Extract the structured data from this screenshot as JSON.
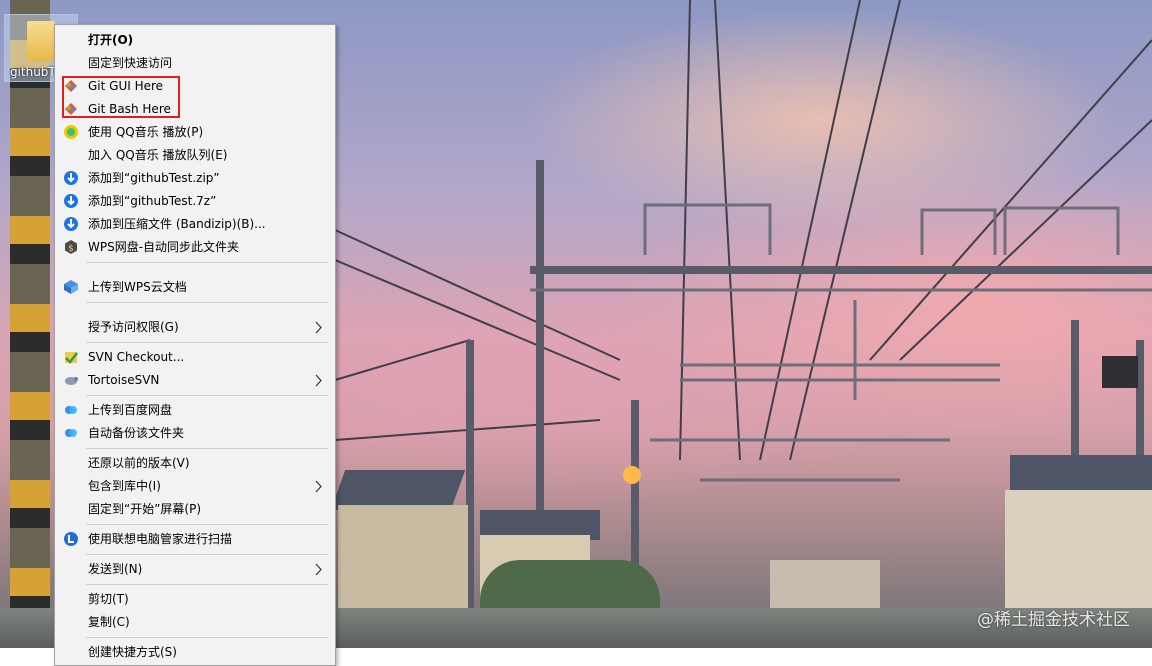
{
  "desktop": {
    "folder_label": "githubTest",
    "watermark": "@稀土掘金技术社区"
  },
  "context_menu": {
    "items": [
      {
        "label": "打开(O)",
        "icon": "none",
        "bold": true
      },
      {
        "label": "固定到快速访问",
        "icon": "none"
      },
      {
        "label": "Git GUI Here",
        "icon": "git-gui-icon"
      },
      {
        "label": "Git Bash Here",
        "icon": "git-bash-icon"
      },
      {
        "label": "使用 QQ音乐 播放(P)",
        "icon": "qq-music-icon"
      },
      {
        "label": "加入 QQ音乐 播放队列(E)",
        "icon": "none"
      },
      {
        "label": "添加到“githubTest.zip”",
        "icon": "bandizip-icon"
      },
      {
        "label": "添加到“githubTest.7z”",
        "icon": "bandizip-icon"
      },
      {
        "label": "添加到压缩文件 (Bandizip)(B)...",
        "icon": "bandizip-icon"
      },
      {
        "label": "WPS网盘-自动同步此文件夹",
        "icon": "wps-drive-icon"
      },
      {
        "label": "上传到WPS云文档",
        "icon": "wps-cloud-icon"
      },
      {
        "label": "授予访问权限(G)",
        "icon": "none",
        "submenu": true
      },
      {
        "label": "SVN Checkout...",
        "icon": "svn-checkout-icon"
      },
      {
        "label": "TortoiseSVN",
        "icon": "tortoisesvn-icon",
        "submenu": true
      },
      {
        "label": "上传到百度网盘",
        "icon": "baidu-netdisk-icon"
      },
      {
        "label": "自动备份该文件夹",
        "icon": "baidu-netdisk-icon"
      },
      {
        "label": "还原以前的版本(V)",
        "icon": "none"
      },
      {
        "label": "包含到库中(I)",
        "icon": "none",
        "submenu": true
      },
      {
        "label": "固定到“开始”屏幕(P)",
        "icon": "none"
      },
      {
        "label": "使用联想电脑管家进行扫描",
        "icon": "lenovo-icon"
      },
      {
        "label": "发送到(N)",
        "icon": "none",
        "submenu": true
      },
      {
        "label": "剪切(T)",
        "icon": "none"
      },
      {
        "label": "复制(C)",
        "icon": "none"
      },
      {
        "label": "创建快捷方式(S)",
        "icon": "none"
      }
    ]
  },
  "colors": {
    "menu_bg": "#f2f2f2",
    "highlight_border": "#e02020"
  }
}
